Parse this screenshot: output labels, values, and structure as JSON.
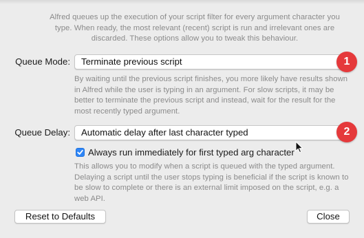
{
  "intro_text": "Alfred queues up the execution of your script filter for every argument character you type. When ready, the most relevant (recent) script is run and irrelevant ones are discarded. These options allow you to tweak this behaviour.",
  "queue_mode": {
    "label": "Queue Mode:",
    "selected": "Terminate previous script",
    "badge": "1",
    "description": "By waiting until the previous script finishes, you more likely have results shown in Alfred while the user is typing in an argument. For slow scripts, it may be better to terminate the previous script and instead, wait for the result for the most recently typed argument."
  },
  "queue_delay": {
    "label": "Queue Delay:",
    "selected": "Automatic delay after last character typed",
    "badge": "2",
    "checkbox_label": "Always run immediately for first typed arg character",
    "checkbox_checked": true,
    "description": "This allows you to modify when a script is queued with the typed argument. Delaying a script until the user stops typing is beneficial if the script is known to be slow to complete or there is an external limit imposed on the script, e.g. a web API."
  },
  "buttons": {
    "reset": "Reset to Defaults",
    "close": "Close"
  },
  "colors": {
    "badge": "#e5393b",
    "checkbox": "#2f86f6",
    "background": "#ececec",
    "description_text": "#8a8a8a"
  },
  "icons": {
    "checkbox": "checkmark-icon",
    "pointer": "mouse-pointer-icon"
  }
}
